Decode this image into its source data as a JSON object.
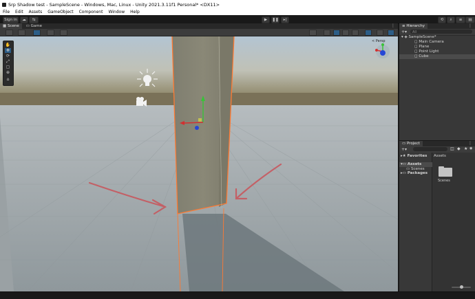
{
  "window": {
    "title": "Srp Shadow test - SampleScene - Windows, Mac, Linux - Unity 2021.3.11f1 Personal* <DX11>"
  },
  "menu": {
    "items": [
      "File",
      "Edit",
      "Assets",
      "GameObject",
      "Component",
      "Window",
      "Help"
    ]
  },
  "toolbar": {
    "sign_in": "Sign in"
  },
  "scene": {
    "tabs": [
      "Scene",
      "Game"
    ],
    "gizmo_label": "< Persp"
  },
  "hierarchy": {
    "tab": "Hierarchy",
    "search_placeholder": "All",
    "scene_name": "SampleScene*",
    "items": [
      "Main Camera",
      "Plane",
      "Point Light",
      "Cube"
    ]
  },
  "project": {
    "tab": "Project",
    "favorites": "Favorites",
    "assets": "Assets",
    "scenes": "Scenes",
    "packages": "Packages",
    "breadcrumb": "Assets",
    "folder_label": "Scenes"
  },
  "colors": {
    "accent": "#2c5d87",
    "selection_outline": "#ff7a32",
    "annotation_arrow": "#c9545a"
  }
}
